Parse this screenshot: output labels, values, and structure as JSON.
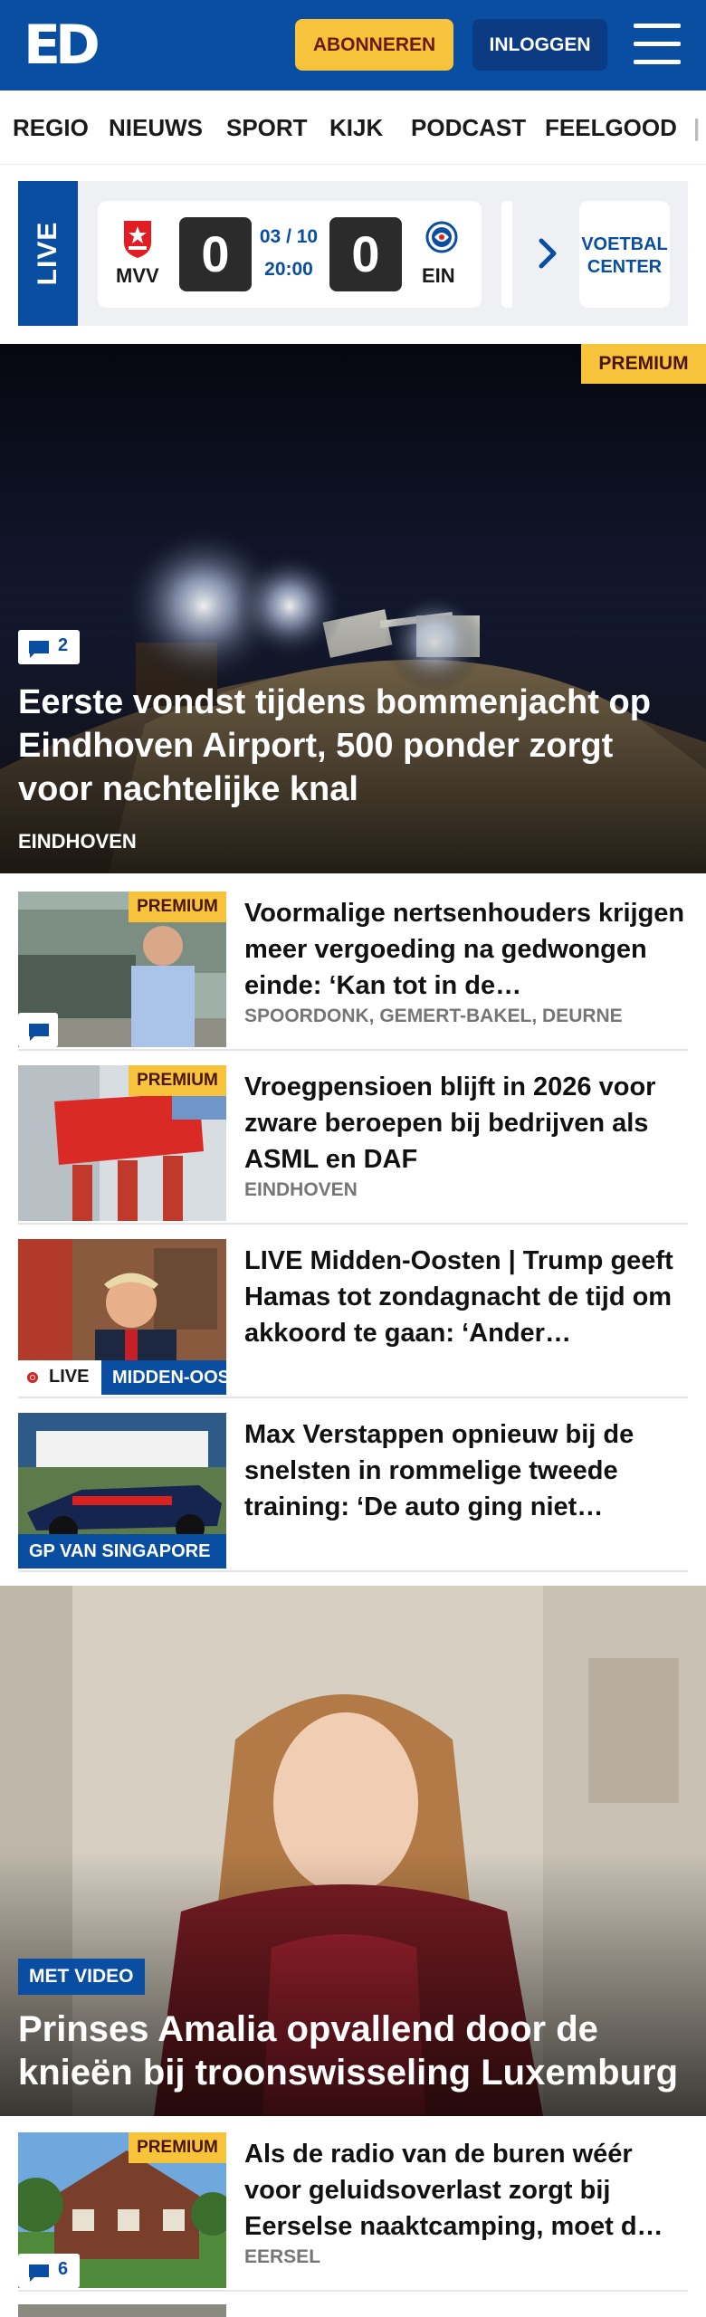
{
  "header": {
    "logo": "ED",
    "subscribe_label": "ABONNEREN",
    "login_label": "INLOGGEN"
  },
  "nav": {
    "items": [
      "REGIO",
      "NIEUWS",
      "SPORT",
      "KIJK",
      "PODCAST",
      "FEELGOOD"
    ]
  },
  "live": {
    "label": "LIVE",
    "match": {
      "home": "MVV",
      "away": "EIN",
      "home_score": "0",
      "away_score": "0",
      "date": "03 / 10",
      "time": "20:00"
    },
    "voetbal_center": "VOETBAL CENTER"
  },
  "hero": {
    "premium": "PREMIUM",
    "comments": "2",
    "title": "Eerste vondst tijdens bommenjacht op Eindhoven Airport, 500 ponder zorgt voor nachtelijke knal",
    "kicker": "EINDHOVEN"
  },
  "articles": [
    {
      "premium": "PREMIUM",
      "title": "Voormalige nertsenhouders krijgen meer vergoeding na gedwongen einde: ‘Kan tot in de…",
      "kicker": "SPOORDONK, GEMERT-BAKEL, DEURNE"
    },
    {
      "premium": "PREMIUM",
      "title": "Vroegpensioen blijft in 2026 voor zware beroepen bij bedrijven als ASML en DAF",
      "kicker": "EINDHOVEN"
    },
    {
      "live": "LIVE",
      "ribbon": "MIDDEN-OOSTEN",
      "title": "LIVE Midden-Oosten | Trump geeft Hamas tot zondagnacht de tijd om akkoord te gaan: ‘Ander…"
    },
    {
      "ribbon": "GP VAN SINGAPORE",
      "title": "Max Verstappen opnieuw bij de snelsten in rommelige tweede training: ‘De auto ging niet…"
    }
  ],
  "feature": {
    "video": "MET VIDEO",
    "title": "Prinses Amalia opvallend door de knieën bij troonswisseling Luxemburg"
  },
  "article_last": {
    "premium": "PREMIUM",
    "comments": "6",
    "title": "Als de radio van de buren wéér voor geluidsoverlast zorgt bij Eerselse naaktcamping, moet d…",
    "kicker": "EERSEL"
  },
  "colors": {
    "brand_blue": "#0a4ea1",
    "premium_yellow": "#f6c33b",
    "live_red": "#d9221f"
  }
}
